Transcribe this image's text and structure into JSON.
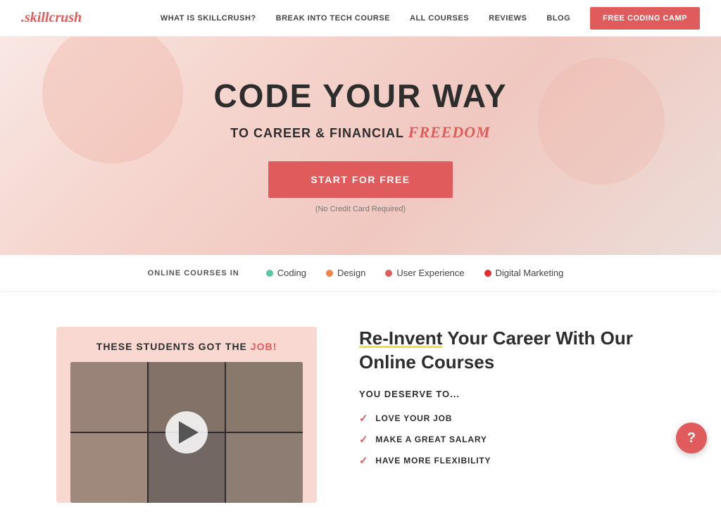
{
  "header": {
    "logo": ".skillcrush",
    "nav": {
      "items": [
        {
          "id": "what-is",
          "label": "WHAT IS SKILLCRUSH?"
        },
        {
          "id": "break-into-tech",
          "label": "BREAK INTO TECH COURSE"
        },
        {
          "id": "all-courses",
          "label": "ALL COURSES"
        },
        {
          "id": "reviews",
          "label": "REVIEWS"
        },
        {
          "id": "blog",
          "label": "BLOG"
        }
      ],
      "cta_label": "FreE CODING CAMP"
    }
  },
  "hero": {
    "title": "CODE YOUR WAY",
    "subtitle_prefix": "TO CAREER & FINANCIAL",
    "subtitle_highlight": "FREEDOM",
    "cta_label": "START FOR FREE",
    "cta_note": "(No Credit Card Required)"
  },
  "courses_bar": {
    "label": "ONLINE COURSES IN",
    "items": [
      {
        "id": "coding",
        "label": "Coding",
        "dot": "green"
      },
      {
        "id": "design",
        "label": "Design",
        "dot": "orange"
      },
      {
        "id": "ux",
        "label": "User Experience",
        "dot": "pink"
      },
      {
        "id": "marketing",
        "label": "Digital Marketing",
        "dot": "red"
      }
    ]
  },
  "main": {
    "video": {
      "title_prefix": "THESE STUDENTS GOT THE",
      "title_highlight": "JOB!",
      "play_label": "Play video"
    },
    "reinvent": {
      "title_underline": "Re-Invent",
      "title_rest": " Your Career With Our Online Courses",
      "deserve_label": "YOU DESERVE TO...",
      "checklist": [
        "LOVE YOUR JOB",
        "MAKE A GREAT SALARY",
        "HAVE MORE FLEXIBILITY"
      ]
    }
  },
  "help": {
    "label": "?"
  }
}
